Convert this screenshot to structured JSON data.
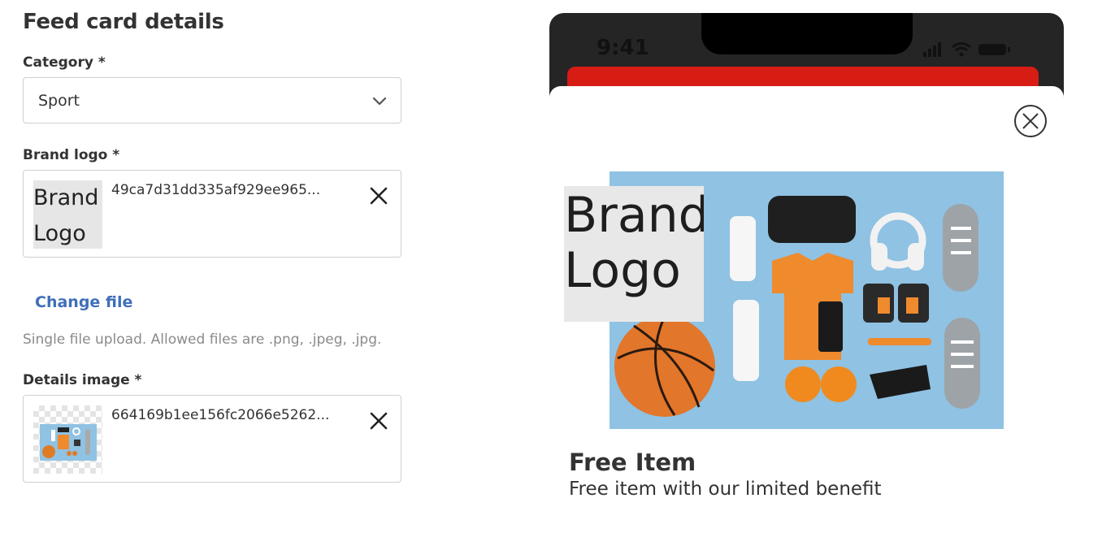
{
  "form": {
    "section_title": "Feed card details",
    "category": {
      "label": "Category *",
      "value": "Sport"
    },
    "brand_logo": {
      "label": "Brand logo *",
      "thumb_text_line1": "Brand",
      "thumb_text_line2": "Logo",
      "filename": "49ca7d31dd335af929ee965..."
    },
    "change_file_label": "Change file",
    "hint": "Single file upload. Allowed files are .png, .jpeg, .jpg.",
    "details_image": {
      "label": "Details image *",
      "filename": "664169b1ee156fc2066e5262..."
    }
  },
  "preview": {
    "status_time": "9:41",
    "hero_logo_line1": "Brand",
    "hero_logo_line2": "Logo",
    "card_title": "Free Item",
    "card_subtitle": "Free item with our limited benefit",
    "colors": {
      "banner": "#d71c14",
      "hero_bg": "#8fc2e3",
      "link": "#3f6fba"
    },
    "icons": [
      "chevron-down-icon",
      "close-icon",
      "signal-icon",
      "wifi-icon",
      "battery-icon",
      "close-circle-icon"
    ]
  }
}
